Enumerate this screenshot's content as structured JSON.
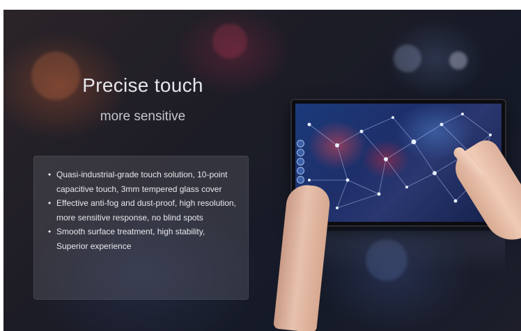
{
  "heading": {
    "title": "Precise touch",
    "subtitle": "more sensitive"
  },
  "features": [
    "Quasi-industrial-grade touch solution, 10-point capacitive touch, 3mm tempered glass cover",
    "Effective anti-fog and dust-proof, high resolution, more sensitive response, no blind spots",
    "Smooth surface treatment, high stability, Superior experience"
  ],
  "colors": {
    "background": "#1c1c26",
    "panel": "#8c8c96",
    "text": "#e8e8ec",
    "screen": "#1e2f6a"
  },
  "icons": [
    "touch-monitor-image",
    "hand-image",
    "toolbar-tool-icon"
  ]
}
